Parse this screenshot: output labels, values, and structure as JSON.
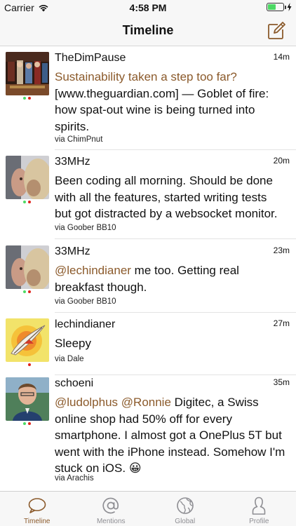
{
  "status_bar": {
    "carrier": "Carrier",
    "time": "4:58 PM",
    "battery_level": 0.5,
    "battery_color": "#4cd964"
  },
  "nav": {
    "title": "Timeline",
    "compose_icon": "compose-icon"
  },
  "accent_color": "#8b5a2b",
  "posts": [
    {
      "username": "TheDimPause",
      "time": "14m",
      "title": "Sustainability taken a step too far?",
      "text": "[www.theguardian.com] — Goblet of fire: how spat-out wine is being turned into spirits.",
      "via": "via ChimPnut"
    },
    {
      "username": "33MHz",
      "time": "20m",
      "text": "Been coding all morning. Should be done with all the features, started writing tests but got distracted by a websocket monitor.",
      "via": "via Goober BB10"
    },
    {
      "username": "33MHz",
      "time": "23m",
      "mention": "@lechindianer",
      "text": " me too. Getting real breakfast though.",
      "via": "via Goober BB10"
    },
    {
      "username": "lechindianer",
      "time": "27m",
      "text": "Sleepy",
      "via": "via Dale"
    },
    {
      "username": "schoeni",
      "time": "35m",
      "mention1": "@ludolphus",
      "mention2": "@Ronnie",
      "text": " Digitec, a Swiss online shop had 50% off for every smartphone. I almost got a OnePlus 5T but went with the iPhone instead. Somehow I'm stuck on iOS. 😀",
      "via": "via Arachis"
    }
  ],
  "tabs": [
    {
      "label": "Timeline",
      "icon": "speech-bubble-icon",
      "active": true
    },
    {
      "label": "Mentions",
      "icon": "at-sign-icon",
      "active": false
    },
    {
      "label": "Global",
      "icon": "globe-icon",
      "active": false
    },
    {
      "label": "Profile",
      "icon": "person-icon",
      "active": false
    }
  ]
}
